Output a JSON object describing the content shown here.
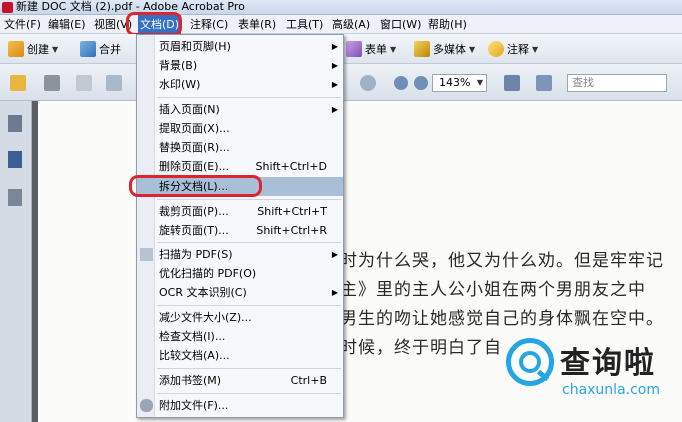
{
  "window": {
    "title": "新建 DOC 文档 (2).pdf - Adobe Acrobat Pro"
  },
  "menubar": {
    "items": [
      "文件(F)",
      "编辑(E)",
      "视图(V)",
      "文档(D)",
      "注释(C)",
      "表单(R)",
      "工具(T)",
      "高级(A)",
      "窗口(W)",
      "帮助(H)"
    ],
    "active_index": 3
  },
  "toolbar": {
    "create": "创建",
    "combine": "合并",
    "forms": "表单",
    "multimedia": "多媒体",
    "comment": "注释"
  },
  "toolbar2": {
    "zoom": "143%",
    "find_placeholder": "查找"
  },
  "document_menu": {
    "items": [
      {
        "label": "页眉和页脚(H)",
        "shortcut": "",
        "submenu": true
      },
      {
        "label": "背景(B)",
        "shortcut": "",
        "submenu": true
      },
      {
        "label": "水印(W)",
        "shortcut": "",
        "submenu": true
      },
      {
        "label": "插入页面(N)",
        "shortcut": "",
        "submenu": true
      },
      {
        "label": "提取页面(X)...",
        "shortcut": "",
        "submenu": false
      },
      {
        "label": "替换页面(R)...",
        "shortcut": "",
        "submenu": false
      },
      {
        "label": "删除页面(E)...",
        "shortcut": "Shift+Ctrl+D",
        "submenu": false
      },
      {
        "label": "拆分文档(L)...",
        "shortcut": "",
        "submenu": false
      },
      {
        "label": "裁剪页面(P)...",
        "shortcut": "Shift+Ctrl+T",
        "submenu": false
      },
      {
        "label": "旋转页面(T)...",
        "shortcut": "Shift+Ctrl+R",
        "submenu": false
      },
      {
        "label": "扫描为 PDF(S)",
        "shortcut": "",
        "submenu": true
      },
      {
        "label": "优化扫描的 PDF(O)",
        "shortcut": "",
        "submenu": false
      },
      {
        "label": "OCR 文本识别(C)",
        "shortcut": "",
        "submenu": true
      },
      {
        "label": "减少文件大小(Z)...",
        "shortcut": "",
        "submenu": false
      },
      {
        "label": "检查文档(I)...",
        "shortcut": "",
        "submenu": false
      },
      {
        "label": "比较文档(A)...",
        "shortcut": "",
        "submenu": false
      },
      {
        "label": "添加书签(M)",
        "shortcut": "Ctrl+B",
        "submenu": false
      },
      {
        "label": "附加文件(F)...",
        "shortcut": "",
        "submenu": false
      }
    ],
    "highlighted_index": 7
  },
  "document_text": {
    "lines": [
      "时为什么哭，他又为什么劝。但是牢牢记",
      "主》里的主人公小姐在两个男朋友之中",
      "男生的吻让她感觉自己的身体飘在空中。",
      "时候，终于明白了自"
    ]
  },
  "watermark": {
    "brand": "查询啦",
    "url": "chaxunla.com"
  },
  "colors": {
    "highlight_ring": "#e0242f",
    "menu_hover": "#a9bfd8",
    "active_menu": "#3570c4",
    "watermark_blue": "#26a5e4"
  }
}
